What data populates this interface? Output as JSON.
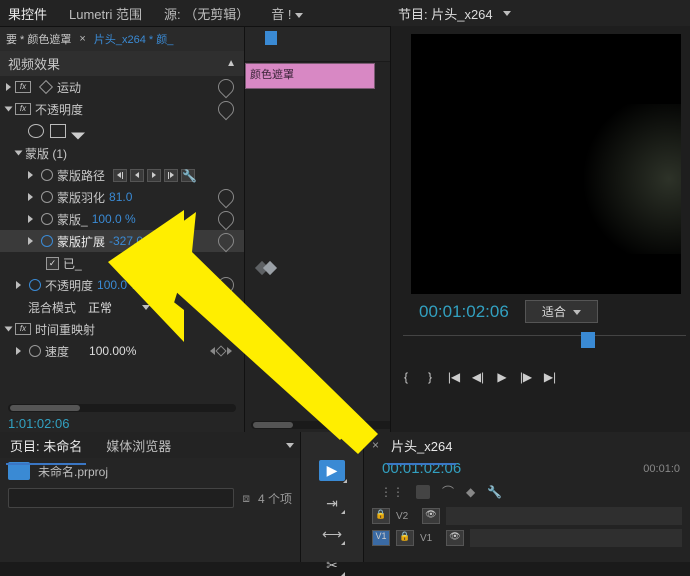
{
  "tabs": {
    "effects": "果控件",
    "lumetri": "Lumetri 范围",
    "source": "源: （无剪辑）",
    "audio": "音 !"
  },
  "program": {
    "title": "节目: 片头_x264"
  },
  "bc": {
    "a": "要 * 颜色遮罩",
    "b": "片头_x264 * 颜_"
  },
  "section": {
    "video": "视频效果",
    "clipname": "颜色遮罩"
  },
  "props": {
    "motion": "运动",
    "opacity": "不透明度",
    "mask": "蒙版 (1)",
    "maskpath": "蒙版路径",
    "feather": "蒙版羽化",
    "featherv": "81.0",
    "maskop": "蒙版_",
    "maskopv": "100.0 %",
    "expand": "蒙版扩展",
    "expandv": "-327.0",
    "inv": "已_",
    "opacity2": "不透明度",
    "opacity2v": "100.0 %",
    "blend": "混合模式",
    "blendv": "正常",
    "timeremap": "时间重映射",
    "speed": "速度",
    "speedv": "100.00%"
  },
  "tc": {
    "left": "1:01:02:06",
    "prog": "00:01:02:06",
    "tl": "00:01:02:06",
    "right": "00:01:0"
  },
  "fit": "适合",
  "proj": {
    "tab1": "页目: 未命名",
    "tab2": "媒体浏览器",
    "file": "未命名.prproj",
    "search": "",
    "count": "4 个项"
  },
  "tl": {
    "tab": "片头_x264",
    "v2": "V2",
    "v1": "V1"
  }
}
